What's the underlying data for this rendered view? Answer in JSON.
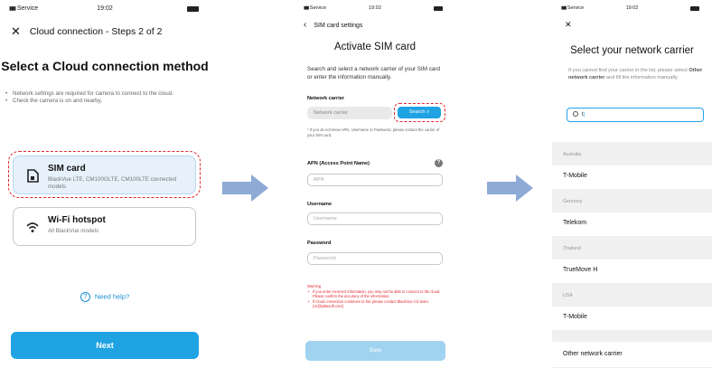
{
  "screen1": {
    "status": {
      "carrier": "Service",
      "time": "19:02"
    },
    "header_title": "Cloud connection - Steps 2 of 2",
    "title": "Select a Cloud connection method",
    "bullets": [
      "Network settings are required for camera to connect to the cloud.",
      "Check the camera is on and nearby."
    ],
    "options": [
      {
        "title": "SIM card",
        "subtitle": "BlackVue LTE, CM100GLTE, CM100LTE connected models",
        "icon": "sim-card-icon"
      },
      {
        "title": "Wi-Fi hotspot",
        "subtitle": "All BlackVue models",
        "icon": "wifi-icon"
      }
    ],
    "help": "Need help?",
    "next": "Next"
  },
  "screen2": {
    "status": {
      "carrier": "Service",
      "time": "19:02"
    },
    "header_title": "SIM card settings",
    "title": "Activate SIM card",
    "intro": "Search and select a network carrier of your SIM card or enter the information manually.",
    "carrier_label": "Network carrier",
    "carrier_placeholder": "Network carrier",
    "search_button": "Search",
    "note": "* If you do not know APN, Username or Password, please contact the carrier of your SIM card.",
    "apn_label": "APN (Access Point Name)",
    "apn_placeholder": "APN",
    "username_label": "Username",
    "username_placeholder": "Username",
    "password_label": "Password",
    "password_placeholder": "Password",
    "warning_title": "Warning",
    "warnings": [
      "If you enter incorrect information, you may not be able to connect to the cloud. Please confirm the accuracy of the information.",
      "If cloud connection continues to fail, please contact BlackVue CS team. (cs@pittasoft.com)"
    ],
    "save": "Save"
  },
  "screen3": {
    "status": {
      "carrier": "Service",
      "time": "19:02"
    },
    "title": "Select your network carrier",
    "intro_prefix": "If you cannot find your carrier in the list, please select ",
    "intro_bold": "Other network carrier",
    "intro_suffix": " and fill the information manually.",
    "search_value": "t",
    "groups": [
      {
        "country": "Australia",
        "carrier": "T-Mobile"
      },
      {
        "country": "Germany",
        "carrier": "Telekom"
      },
      {
        "country": "Thailand",
        "carrier": "TrueMove H"
      },
      {
        "country": "USA",
        "carrier": "T-Mobile"
      }
    ],
    "other": "Other network carrier"
  },
  "colors": {
    "accent": "#1fa3e3",
    "highlight_dash": "#e0282e",
    "arrow": "#8eaad6"
  }
}
